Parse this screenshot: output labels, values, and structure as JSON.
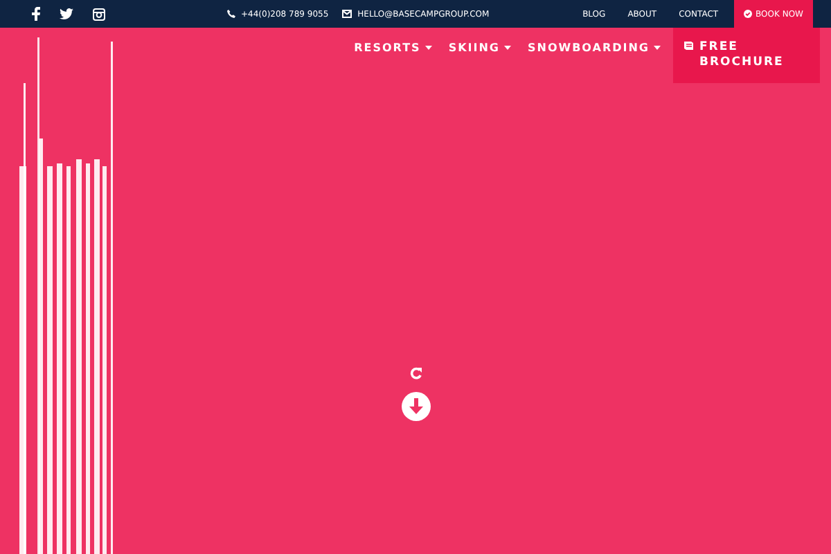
{
  "topbar": {
    "phone": "+44(0)208 789 9055",
    "email": "HELLO@BASECAMPGROUP.COM",
    "links": [
      "BLOG",
      "ABOUT",
      "CONTACT"
    ],
    "book": "BOOK NOW"
  },
  "nav": {
    "items": [
      {
        "label": "RESORTS",
        "dropdown": true
      },
      {
        "label": "SKIING",
        "dropdown": true
      },
      {
        "label": "SNOWBOARDING",
        "dropdown": true
      }
    ],
    "brochure": "FREE BROCHURE"
  }
}
